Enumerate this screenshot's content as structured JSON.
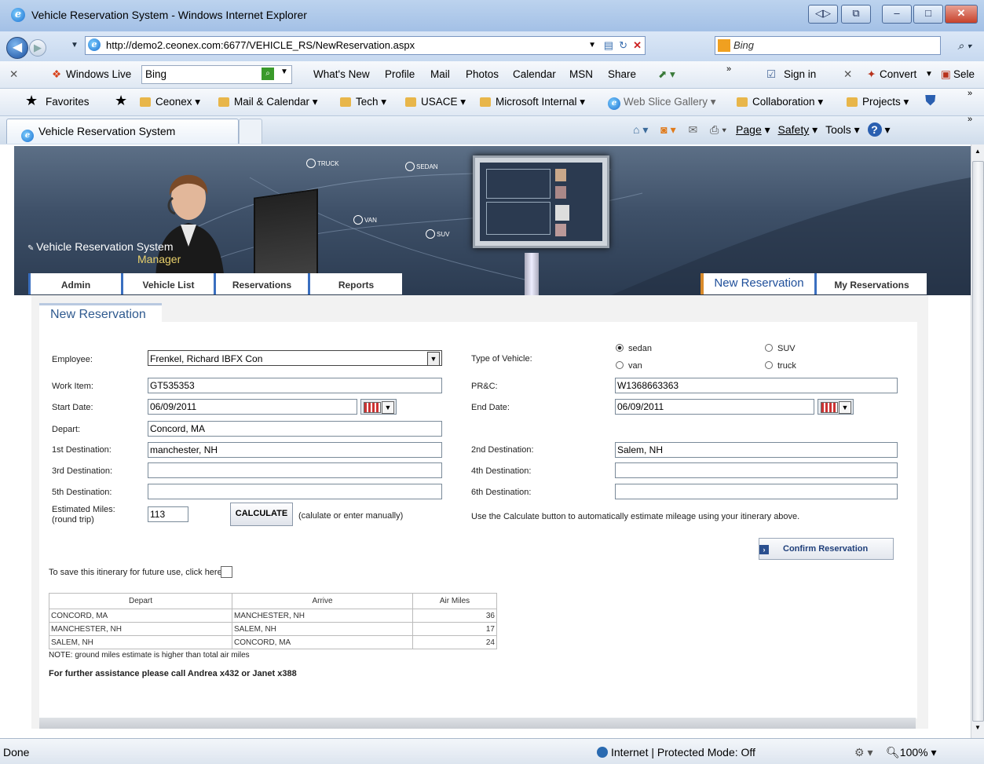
{
  "window": {
    "title": "Vehicle Reservation System - Windows Internet Explorer"
  },
  "address": {
    "url": "http://demo2.ceonex.com:6677/VEHICLE_RS/NewReservation.aspx",
    "search_engine": "Bing"
  },
  "toolbar1": {
    "windows_live": "Windows Live",
    "search_value": "Bing",
    "links": [
      "What's New",
      "Profile",
      "Mail",
      "Photos",
      "Calendar",
      "MSN",
      "Share"
    ],
    "sign_in": "Sign in",
    "convert": "Convert",
    "select": "Sele"
  },
  "favorites_bar": {
    "favorites": "Favorites",
    "items": [
      "Ceonex",
      "Mail & Calendar",
      "Tech",
      "USACE",
      "Microsoft Internal",
      "Web Slice Gallery",
      "Collaboration",
      "Projects"
    ]
  },
  "tab": {
    "title": "Vehicle Reservation System"
  },
  "command_bar": {
    "page": "Page",
    "safety": "Safety",
    "tools": "Tools"
  },
  "banner": {
    "system_title": "Vehicle Reservation System",
    "subtitle": "Manager",
    "vehicle_labels": [
      "TRUCK",
      "SEDAN",
      "VAN",
      "SUV"
    ]
  },
  "nav": {
    "left_tabs": [
      "Admin",
      "Vehicle List",
      "Reservations",
      "Reports"
    ],
    "active_tab": "New Reservation",
    "right_tab": "My Reservations"
  },
  "form": {
    "section_title": "New Reservation",
    "employee_label": "Employee:",
    "employee_value": "Frenkel, Richard IBFX Con",
    "vehicle_type_label": "Type of Vehicle:",
    "vehicle_types": {
      "sedan": "sedan",
      "suv": "SUV",
      "van": "van",
      "truck": "truck"
    },
    "selected_vehicle": "sedan",
    "work_item_label": "Work Item:",
    "work_item_value": "GT535353",
    "prc_label": "PR&C:",
    "prc_value": "W1368663363",
    "start_date_label": "Start Date:",
    "start_date_value": "06/09/2011",
    "end_date_label": "End Date:",
    "end_date_value": "06/09/2011",
    "depart_label": "Depart:",
    "depart_value": "Concord, MA",
    "dest1_label": "1st Destination:",
    "dest1_value": "manchester, NH",
    "dest2_label": "2nd Destination:",
    "dest2_value": "Salem, NH",
    "dest3_label": "3rd Destination:",
    "dest3_value": "",
    "dest4_label": "4th Destination:",
    "dest4_value": "",
    "dest5_label": "5th Destination:",
    "dest5_value": "",
    "dest6_label": "6th Destination:",
    "dest6_value": "",
    "miles_label": "Estimated Miles:",
    "miles_sublabel": "(round trip)",
    "miles_value": "113",
    "calculate_label": "CALCULATE",
    "calculate_hint": "(calulate or enter manually)",
    "calculate_help": "Use the Calculate button to automatically estimate mileage using your itinerary above.",
    "confirm_label": "Confirm Reservation",
    "save_itinerary_label": "To save this itinerary for future use, click here:"
  },
  "itinerary": {
    "headers": [
      "Depart",
      "Arrive",
      "Air Miles"
    ],
    "rows": [
      [
        "CONCORD, MA",
        "MANCHESTER, NH",
        "36"
      ],
      [
        "MANCHESTER, NH",
        "SALEM, NH",
        "17"
      ],
      [
        "SALEM, NH",
        "CONCORD, MA",
        "24"
      ]
    ],
    "note": "NOTE: ground miles estimate is higher than total air miles",
    "assistance": "For further assistance please call Andrea x432 or Janet x388"
  },
  "status": {
    "left": "Done",
    "zone": "Internet | Protected Mode: Off",
    "zoom": "100%"
  },
  "colors": {
    "accent_blue": "#1f4f9a",
    "tab_orange": "#d98a2a",
    "banner": "#3e5068"
  }
}
